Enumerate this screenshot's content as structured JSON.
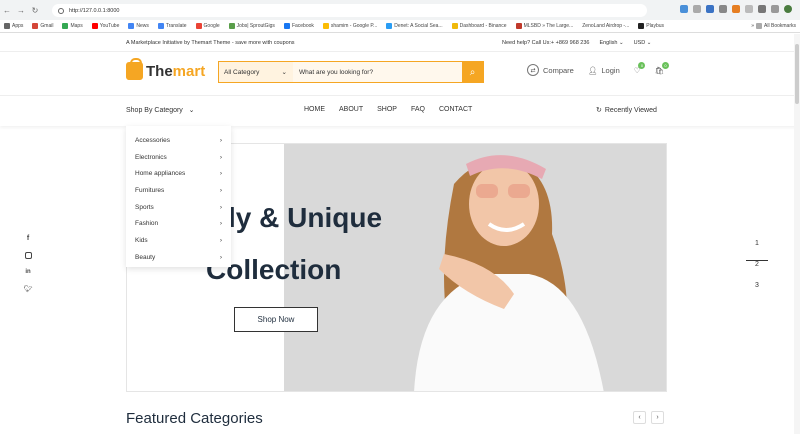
{
  "browser": {
    "url": "http://127.0.0.1:8000",
    "bookmarks": [
      "Apps",
      "Gmail",
      "Maps",
      "YouTube",
      "News",
      "Translate",
      "Google",
      "Jobs| SproutGigs",
      "Facebook",
      "shamim - Google P...",
      "Denet: A Social Sea...",
      "Dashboard - Binance",
      "MLSBD » The Large...",
      "ZenoLand Airdrop -...",
      "Playbus",
      "All Bookmarks"
    ]
  },
  "topbar": {
    "tagline": "A Marketplace Initiative by Themart Theme - save more with coupons",
    "help": "Need help? Call Us:+ +869 968 236",
    "language": "English",
    "currency": "USD"
  },
  "header": {
    "logo_a": "The",
    "logo_b": "mart",
    "category_select": "All Category",
    "search_placeholder": "What are you looking for?",
    "compare": "Compare",
    "login": "Login",
    "wishlist_count": "0",
    "cart_count": "0"
  },
  "nav": {
    "shop_by_category": "Shop By Category",
    "menu": [
      "HOME",
      "ABOUT",
      "SHOP",
      "FAQ",
      "CONTACT"
    ],
    "recently_viewed": "Recently Viewed"
  },
  "categories": [
    "Accessories",
    "Electronics",
    "Home appliances",
    "Furnitures",
    "Sports",
    "Fashion",
    "Kids",
    "Beauty"
  ],
  "hero": {
    "title_line1": "ly & Unique",
    "title_line2": "Collection",
    "button": "Shop Now",
    "slides": [
      "1",
      "2",
      "3"
    ]
  },
  "social": [
    "f",
    "ig",
    "in",
    "tw"
  ],
  "featured": {
    "title": "Featured Categories"
  }
}
